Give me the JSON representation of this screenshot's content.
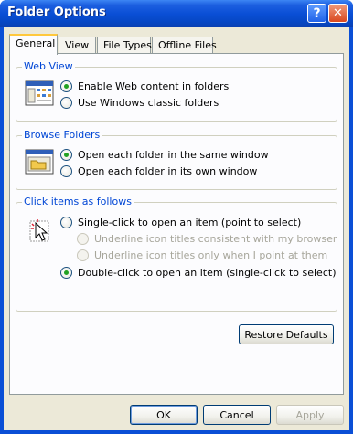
{
  "window": {
    "title": "Folder Options"
  },
  "title_buttons": {
    "help": "?",
    "close": "✕"
  },
  "tabs": [
    {
      "label": "General"
    },
    {
      "label": "View"
    },
    {
      "label": "File Types"
    },
    {
      "label": "Offline Files"
    }
  ],
  "web_view": {
    "label": "Web View",
    "options": [
      {
        "label": "Enable Web content in folders",
        "checked": true
      },
      {
        "label": "Use Windows classic folders",
        "checked": false
      }
    ]
  },
  "browse_folders": {
    "label": "Browse Folders",
    "options": [
      {
        "label": "Open each folder in the same window",
        "checked": true
      },
      {
        "label": "Open each folder in its own window",
        "checked": false
      }
    ]
  },
  "click_items": {
    "label": "Click items as follows",
    "single_click": "Single-click to open an item (point to select)",
    "underline_browser": "Underline icon titles consistent with my browser",
    "underline_point": "Underline icon titles only when I point at them",
    "double_click": "Double-click to open an item (single-click to select)"
  },
  "buttons": {
    "restore_defaults": "Restore Defaults",
    "ok": "OK",
    "cancel": "Cancel",
    "apply": "Apply"
  },
  "colors": {
    "titlebar": "#0a4fd6",
    "client": "#ece9d8",
    "group_label": "#0046d5",
    "radio_dot": "#21a121"
  }
}
